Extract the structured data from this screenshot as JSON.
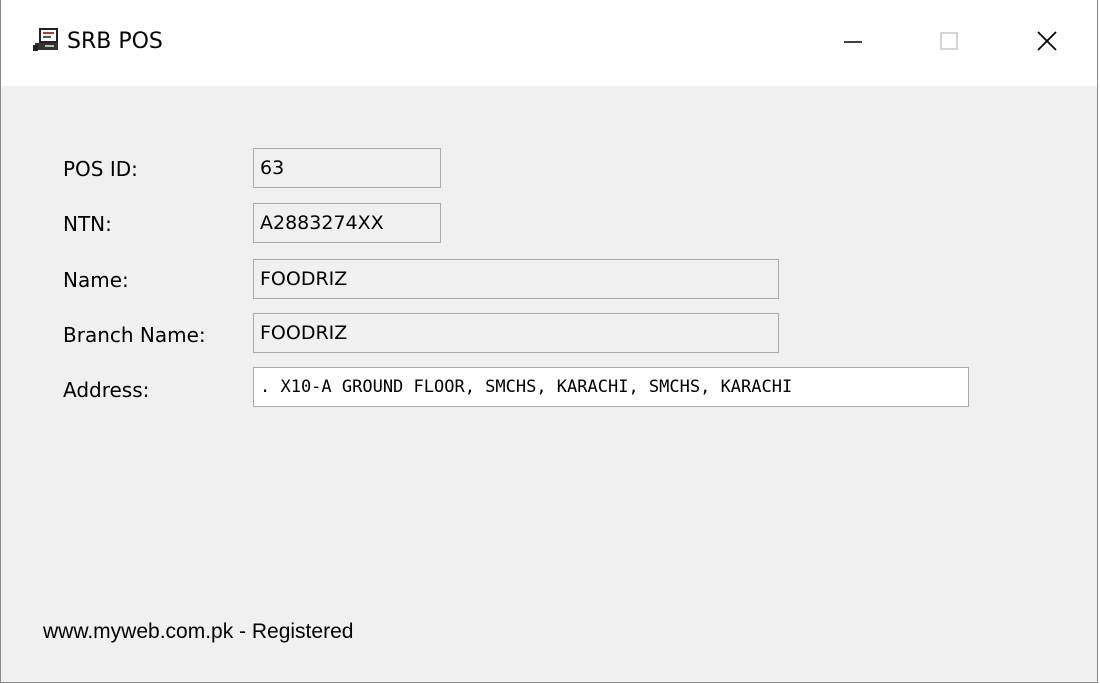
{
  "window": {
    "title": "SRB POS",
    "icon": "pos-terminal-icon",
    "controls": {
      "minimize": "minimize-icon",
      "maximize": "maximize-icon",
      "close": "close-icon"
    }
  },
  "form": {
    "pos_id": {
      "label": "POS ID:",
      "value": "63"
    },
    "ntn": {
      "label": "NTN:",
      "value": "A2883274XX"
    },
    "name": {
      "label": "Name:",
      "value": "FOODRIZ"
    },
    "branch_name": {
      "label": "Branch Name:",
      "value": "FOODRIZ"
    },
    "address": {
      "label": "Address:",
      "value": ". X10-A GROUND FLOOR, SMCHS, KARACHI, SMCHS, KARACHI"
    }
  },
  "footer": {
    "status_text": "www.myweb.com.pk - Registered"
  },
  "colors": {
    "window_background": "#f0f0f0",
    "titlebar_background": "#ffffff",
    "field_border": "#a9a9a9"
  }
}
